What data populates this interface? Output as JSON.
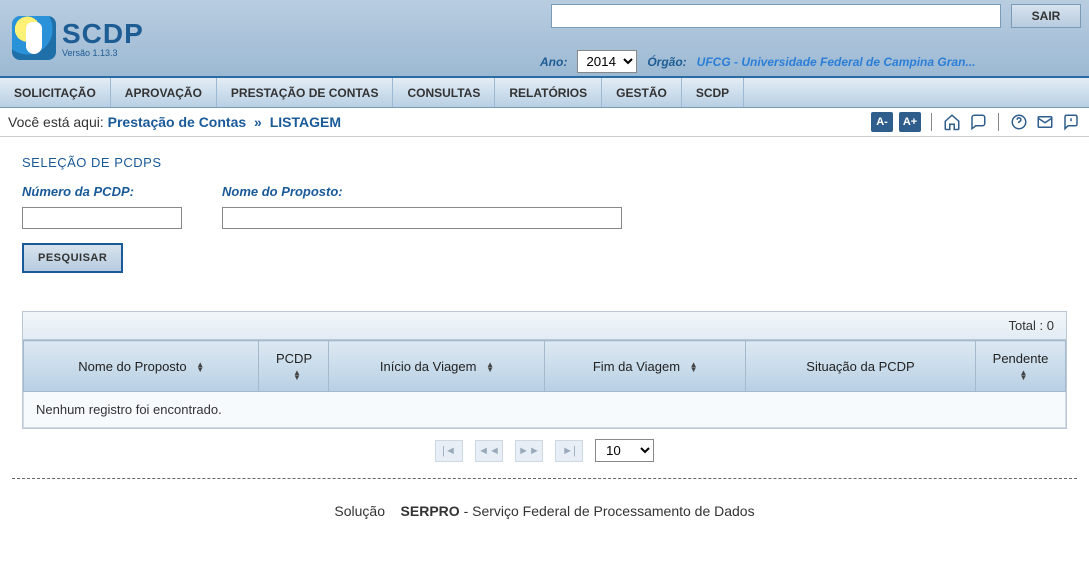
{
  "brand": {
    "name": "SCDP",
    "version_label": "Versão 1.13.3"
  },
  "header": {
    "exit_label": "SAIR",
    "year_label": "Ano:",
    "year_value": "2014",
    "orgao_label": "Órgão:",
    "orgao_value": "UFCG - Universidade Federal de Campina Gran..."
  },
  "menu": [
    "SOLICITAÇÃO",
    "APROVAÇÃO",
    "PRESTAÇÃO DE CONTAS",
    "CONSULTAS",
    "RELATÓRIOS",
    "GESTÃO",
    "SCDP"
  ],
  "breadcrumb": {
    "prefix": "Você está aqui:",
    "link": "Prestação de Contas",
    "separator": "»",
    "current": "LISTAGEM"
  },
  "toolbar_icons": {
    "decrease": "A-",
    "increase": "A+"
  },
  "form": {
    "panel_title": "SELEÇÃO DE PCDPS",
    "pcdp_label": "Número da PCDP:",
    "pcdp_value": "",
    "nome_label": "Nome do Proposto:",
    "nome_value": "",
    "search_button": "PESQUISAR"
  },
  "table": {
    "total_label": "Total : 0",
    "columns": {
      "nome": "Nome do Proposto",
      "pcdp": "PCDP",
      "inicio": "Início da Viagem",
      "fim": "Fim da Viagem",
      "situacao": "Situação da PCDP",
      "pendente": "Pendente"
    },
    "empty_message": "Nenhum registro foi encontrado."
  },
  "pager": {
    "page_size": "10"
  },
  "footer": {
    "prefix": "Solução",
    "brand": "SERPRO",
    "suffix": "  - Serviço Federal de Processamento de Dados"
  }
}
